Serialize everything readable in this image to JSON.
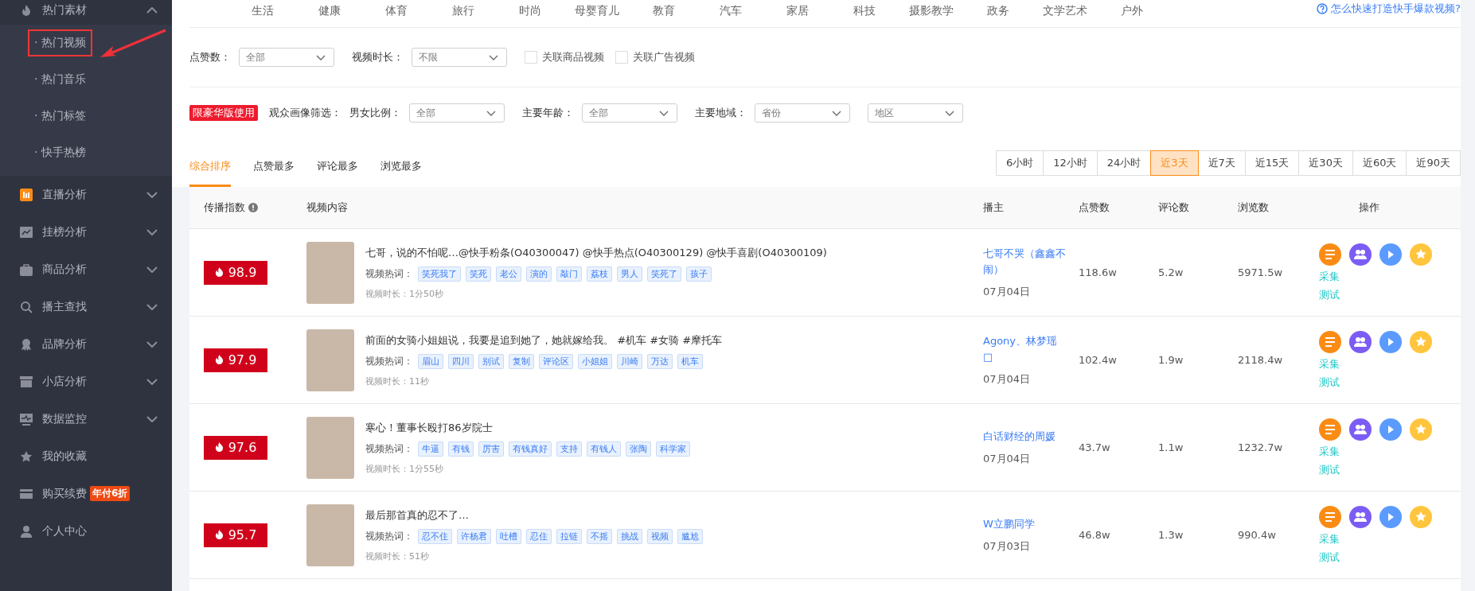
{
  "sidebar": {
    "items": [
      {
        "label": "热门素材",
        "expanded": true,
        "children": [
          {
            "label": "· 热门视频",
            "annotated": true
          },
          {
            "label": "· 热门音乐",
            "annotated": false
          },
          {
            "label": "· 热门标签",
            "annotated": false
          },
          {
            "label": "· 快手热榜",
            "annotated": false
          }
        ]
      },
      {
        "label": "直播分析",
        "expanded": false
      },
      {
        "label": "挂榜分析",
        "expanded": false
      },
      {
        "label": "商品分析",
        "expanded": false
      },
      {
        "label": "播主查找",
        "expanded": false
      },
      {
        "label": "品牌分析",
        "expanded": false
      },
      {
        "label": "小店分析",
        "expanded": false
      },
      {
        "label": "数据监控",
        "expanded": false
      },
      {
        "label": "我的收藏"
      },
      {
        "label": "购买续费",
        "badge": "年付6折"
      },
      {
        "label": "个人中心"
      }
    ]
  },
  "categories": [
    "生活",
    "健康",
    "体育",
    "旅行",
    "时尚",
    "母婴育儿",
    "教育",
    "汽车",
    "家居",
    "科技",
    "摄影教学",
    "政务",
    "文学艺术",
    "户外"
  ],
  "help_link": "怎么快速打造快手爆款视频?",
  "filters": [
    {
      "kind": "select",
      "label": "点赞数：",
      "value": "全部"
    },
    {
      "kind": "select",
      "label": "视频时长：",
      "value": "不限"
    },
    {
      "kind": "checkbox",
      "label": "关联商品视频",
      "checked": false
    },
    {
      "kind": "checkbox",
      "label": "关联广告视频",
      "checked": false
    }
  ],
  "audience_filter": {
    "badge": "限豪华版使用",
    "title": "观众画像筛选：",
    "selects": [
      {
        "label": "男女比例：",
        "value": "全部"
      },
      {
        "label": "主要年龄：",
        "value": "全部"
      },
      {
        "label": "主要地域：",
        "value": "省份"
      },
      {
        "value": "地区"
      }
    ]
  },
  "sort_tabs": [
    {
      "label": "综合排序",
      "selected": true
    },
    {
      "label": "点赞最多",
      "selected": false
    },
    {
      "label": "评论最多",
      "selected": false
    },
    {
      "label": "浏览最多",
      "selected": false
    }
  ],
  "time_ranges": [
    {
      "label": "6小时",
      "selected": false
    },
    {
      "label": "12小时",
      "selected": false
    },
    {
      "label": "24小时",
      "selected": false
    },
    {
      "label": "近3天",
      "selected": true
    },
    {
      "label": "近7天",
      "selected": false
    },
    {
      "label": "近15天",
      "selected": false
    },
    {
      "label": "近30天",
      "selected": false
    },
    {
      "label": "近60天",
      "selected": false
    },
    {
      "label": "近90天",
      "selected": false
    }
  ],
  "table": {
    "columns": [
      "传播指数",
      "视频内容",
      "播主",
      "点赞数",
      "评论数",
      "浏览数",
      "操作"
    ],
    "rows": [
      {
        "score": "98.9",
        "title": "七哥，说的不怕呢…@快手粉条(O40300047) @快手热点(O40300129) @快手喜剧(O40300109)",
        "tags_label": "视频热词：",
        "tags": [
          "笑死我了",
          "笑死",
          "老公",
          "演的",
          "敲门",
          "荔枝",
          "男人",
          "笑死了",
          "孩子"
        ],
        "duration": "视频时长：1分50秒",
        "author": "七哥不哭（鑫鑫不闹）",
        "date": "07月04日",
        "likes": "118.6w",
        "comments": "5.2w",
        "views": "5971.5w",
        "actions": [
          "采集",
          "测试"
        ]
      },
      {
        "score": "97.9",
        "title": "前面的女骑小姐姐说，我要是追到她了，她就嫁给我。 #机车 #女骑 #摩托车",
        "tags_label": "视频热词：",
        "tags": [
          "眉山",
          "四川",
          "别试",
          "复制",
          "评论区",
          "小姐姐",
          "川崎",
          "万达",
          "机车"
        ],
        "duration": "视频时长：11秒",
        "author": "Agony、林梦瑶□",
        "date": "07月04日",
        "likes": "102.4w",
        "comments": "1.9w",
        "views": "2118.4w",
        "actions": [
          "采集",
          "测试"
        ]
      },
      {
        "score": "97.6",
        "title": "寒心！董事长殴打86岁院士",
        "tags_label": "视频热词：",
        "tags": [
          "牛逼",
          "有钱",
          "厉害",
          "有钱真好",
          "支持",
          "有钱人",
          "张陶",
          "科学家"
        ],
        "duration": "视频时长：1分55秒",
        "author": "白话财经的周媛",
        "date": "07月04日",
        "likes": "43.7w",
        "comments": "1.1w",
        "views": "1232.7w",
        "actions": [
          "采集",
          "测试"
        ]
      },
      {
        "score": "95.7",
        "title": "最后那首真的忍不了…",
        "tags_label": "视频热词：",
        "tags": [
          "忍不住",
          "许杨君",
          "吐槽",
          "忍住",
          "拉链",
          "不摇",
          "挑战",
          "视频",
          "尴尬"
        ],
        "duration": "视频时长：51秒",
        "author": "W立鹏同学",
        "date": "07月03日",
        "likes": "46.8w",
        "comments": "1.3w",
        "views": "990.4w",
        "actions": [
          "采集",
          "测试"
        ]
      }
    ]
  }
}
